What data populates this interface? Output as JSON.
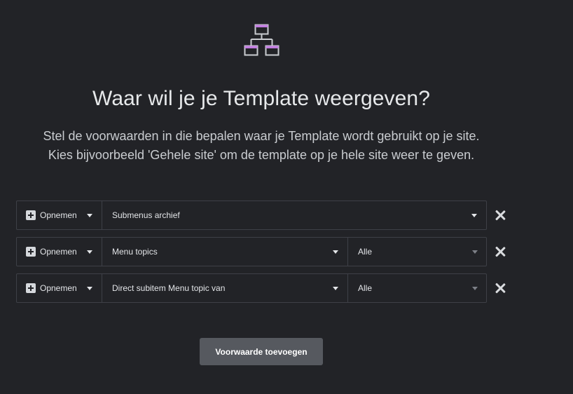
{
  "header": {
    "icon": "sitemap-icon",
    "icon_accent": "#c27ce0",
    "title": "Waar wil je je Template weergeven?",
    "subtitle_line1": "Stel de voorwaarden in die bepalen waar je Template wordt gebruikt op je site.",
    "subtitle_line2": "Kies bijvoorbeeld 'Gehele site' om de template op je hele site weer te geven."
  },
  "conditions": [
    {
      "type": "Opnemen",
      "main": "Submenus archief",
      "sub": null
    },
    {
      "type": "Opnemen",
      "main": "Menu topics",
      "sub": "Alle"
    },
    {
      "type": "Opnemen",
      "main": "Direct subitem Menu topic van",
      "sub": "Alle"
    }
  ],
  "actions": {
    "add_label": "Voorwaarde toevoegen"
  },
  "colors": {
    "background": "#222327",
    "border": "#3e4047",
    "button": "#56595f"
  }
}
